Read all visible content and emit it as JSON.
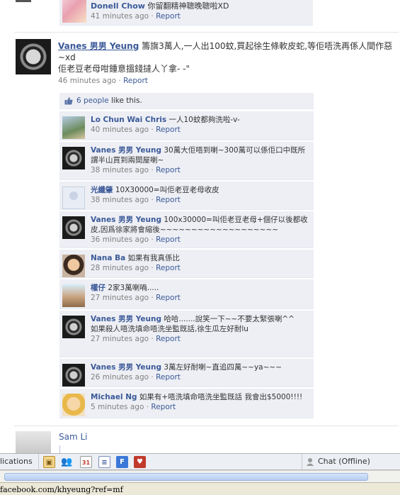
{
  "top_comment": {
    "name": "Donell Chow",
    "text": "你留翻精神聰晚聰啦XD",
    "time": "41 minutes ago",
    "report": "Report"
  },
  "post": {
    "name": "Vanes 男男 Yeung",
    "text": "籌旗3萬人,一人出100蚊,買起徐生條軟皮蛇,等佢唔洗再係人間作惡~xd",
    "text2": "佢老豆老母咁鍾意搵錢撻人丫拿- -\"",
    "time": "46 minutes ago",
    "report": "Report"
  },
  "likes": {
    "text": "6 people",
    "suffix": " like this."
  },
  "comments": [
    {
      "name": "Lo Chun Wai Chris",
      "text": "一人10蚊都夠洗啦-v-",
      "time": "40 minutes ago",
      "report": "Report"
    },
    {
      "name": "Vanes 男男 Yeung",
      "text": "30萬大佢唔到喇~300萬可以係佢口中既所謂半山買到兩間屋喇~",
      "time": "38 minutes ago",
      "report": "Report"
    },
    {
      "name": "光纖肇",
      "text": "10X30000=叫佢老豆老母收皮",
      "time": "38 minutes ago",
      "report": "Report"
    },
    {
      "name": "Vanes 男男 Yeung",
      "text": "100x30000=叫佢老豆老母+個仔以後都收皮,因爲徐家將會縮後~~~~~~~~~~~~~~~~~~~",
      "time": "36 minutes ago",
      "report": "Report"
    },
    {
      "name": "Nana Ba",
      "text": "如果有我真係比",
      "time": "28 minutes ago",
      "report": "Report"
    },
    {
      "name": "權仔",
      "text": "2家3萬喇喎.....",
      "time": "27 minutes ago",
      "report": "Report"
    },
    {
      "name": "Vanes 男男 Yeung",
      "text": "哈哈.......說笑一下~~不要太緊張喇^^",
      "text2": "如果殺人唔洗填命唔洗坐監既話,徐生瓜左好耐lu",
      "time": "27 minutes ago",
      "report": "Report"
    },
    {
      "name": "Vanes 男男 Yeung",
      "text": "3萬左好耐喇~直追四萬~~ya~~~",
      "time": "26 minutes ago",
      "report": "Report"
    },
    {
      "name": "Michael Ng",
      "text": "如果有+唔洗填命唔洗坐監既話 我會出$5000!!!!",
      "time": "5 minutes ago",
      "report": "Report"
    }
  ],
  "next_post": {
    "name": "Sam Li"
  },
  "appbar": {
    "apps_label": "lications",
    "chat_label": "Chat (Offline)"
  },
  "statusbar": {
    "url": "facebook.com/khyeung?ref=mf"
  },
  "colors": {
    "link": "#3b5998",
    "comment_bg": "#edeff4",
    "meta": "#808080"
  }
}
